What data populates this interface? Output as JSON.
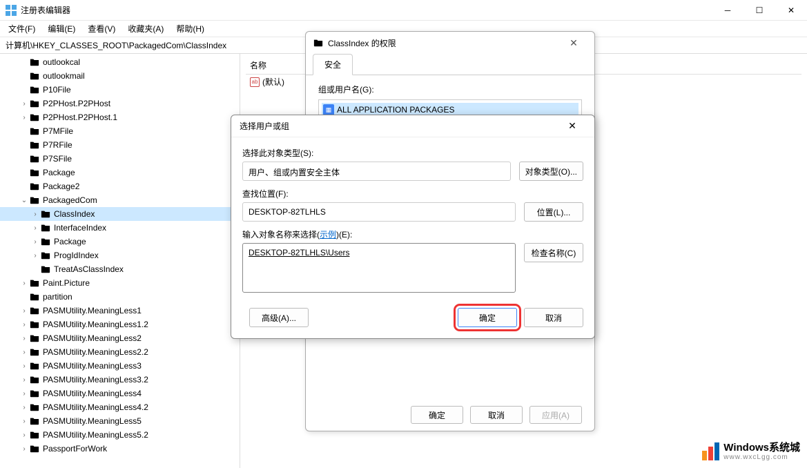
{
  "window": {
    "title": "注册表编辑器"
  },
  "menu": {
    "file": "文件(F)",
    "edit": "编辑(E)",
    "view": "查看(V)",
    "fav": "收藏夹(A)",
    "help": "帮助(H)"
  },
  "address": "计算机\\HKEY_CLASSES_ROOT\\PackagedCom\\ClassIndex",
  "tree": [
    {
      "l": 1,
      "e": "",
      "n": "outlookcal"
    },
    {
      "l": 1,
      "e": "",
      "n": "outlookmail"
    },
    {
      "l": 1,
      "e": "",
      "n": "P10File"
    },
    {
      "l": 1,
      "e": ">",
      "n": "P2PHost.P2PHost"
    },
    {
      "l": 1,
      "e": ">",
      "n": "P2PHost.P2PHost.1"
    },
    {
      "l": 1,
      "e": "",
      "n": "P7MFile"
    },
    {
      "l": 1,
      "e": "",
      "n": "P7RFile"
    },
    {
      "l": 1,
      "e": "",
      "n": "P7SFile"
    },
    {
      "l": 1,
      "e": "",
      "n": "Package"
    },
    {
      "l": 1,
      "e": "",
      "n": "Package2"
    },
    {
      "l": 1,
      "e": "v",
      "n": "PackagedCom"
    },
    {
      "l": 2,
      "e": ">",
      "n": "ClassIndex",
      "sel": true
    },
    {
      "l": 2,
      "e": ">",
      "n": "InterfaceIndex"
    },
    {
      "l": 2,
      "e": ">",
      "n": "Package"
    },
    {
      "l": 2,
      "e": ">",
      "n": "ProgIdIndex"
    },
    {
      "l": 2,
      "e": "",
      "n": "TreatAsClassIndex"
    },
    {
      "l": 1,
      "e": ">",
      "n": "Paint.Picture"
    },
    {
      "l": 1,
      "e": "",
      "n": "partition"
    },
    {
      "l": 1,
      "e": ">",
      "n": "PASMUtility.MeaningLess1"
    },
    {
      "l": 1,
      "e": ">",
      "n": "PASMUtility.MeaningLess1.2"
    },
    {
      "l": 1,
      "e": ">",
      "n": "PASMUtility.MeaningLess2"
    },
    {
      "l": 1,
      "e": ">",
      "n": "PASMUtility.MeaningLess2.2"
    },
    {
      "l": 1,
      "e": ">",
      "n": "PASMUtility.MeaningLess3"
    },
    {
      "l": 1,
      "e": ">",
      "n": "PASMUtility.MeaningLess3.2"
    },
    {
      "l": 1,
      "e": ">",
      "n": "PASMUtility.MeaningLess4"
    },
    {
      "l": 1,
      "e": ">",
      "n": "PASMUtility.MeaningLess4.2"
    },
    {
      "l": 1,
      "e": ">",
      "n": "PASMUtility.MeaningLess5"
    },
    {
      "l": 1,
      "e": ">",
      "n": "PASMUtility.MeaningLess5.2"
    },
    {
      "l": 1,
      "e": ">",
      "n": "PassportForWork"
    }
  ],
  "list": {
    "header_name": "名称",
    "default_value": "(默认)"
  },
  "perm_dialog": {
    "title": "ClassIndex 的权限",
    "tab_security": "安全",
    "group_label": "组或用户名(G):",
    "group_item": "ALL APPLICATION PACKAGES",
    "ok": "确定",
    "cancel": "取消",
    "apply": "应用(A)"
  },
  "sel_dialog": {
    "title": "选择用户或组",
    "type_label": "选择此对象类型(S):",
    "type_value": "用户、组或内置安全主体",
    "type_btn": "对象类型(O)...",
    "loc_label": "查找位置(F):",
    "loc_value": "DESKTOP-82TLHLS",
    "loc_btn": "位置(L)...",
    "names_label_pre": "输入对象名称来选择(",
    "names_label_link": "示例",
    "names_label_post": ")(E):",
    "names_value": "DESKTOP-82TLHLS\\Users",
    "check_btn": "检查名称(C)",
    "adv_btn": "高级(A)...",
    "ok": "确定",
    "cancel": "取消"
  },
  "watermark": {
    "big": "Windows系统城",
    "small": "www.wxcLgg.com"
  }
}
